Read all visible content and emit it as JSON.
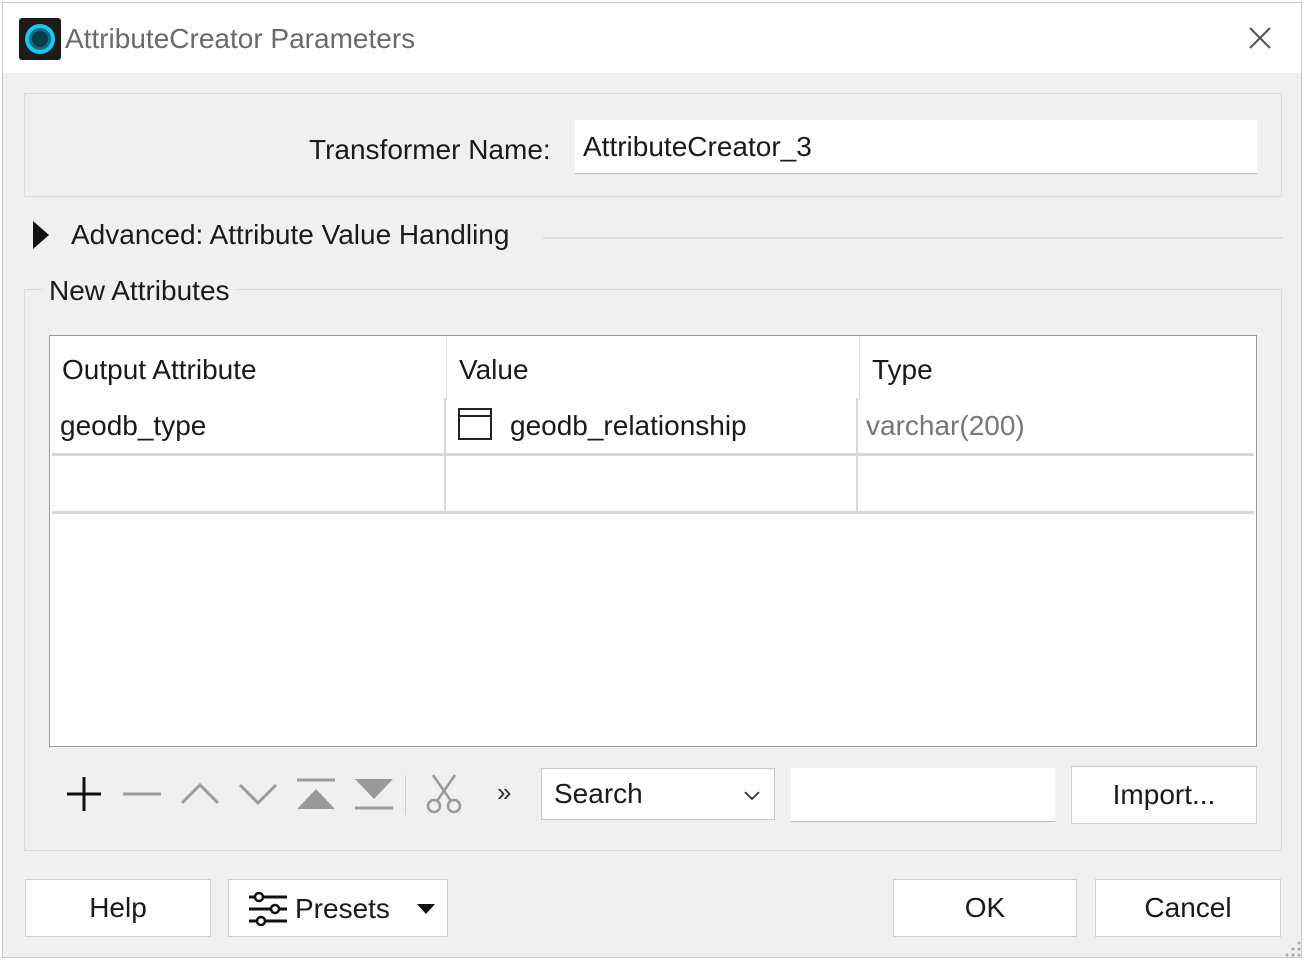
{
  "window": {
    "title": "AttributeCreator Parameters",
    "accent_color": "#18c8e8"
  },
  "transformer": {
    "label": "Transformer Name:",
    "value": "AttributeCreator_3"
  },
  "advanced": {
    "label": "Advanced: Attribute Value Handling",
    "expanded": false
  },
  "new_attributes": {
    "section_label": "New Attributes",
    "columns": [
      "Output Attribute",
      "Value",
      "Type"
    ],
    "rows": [
      {
        "output_attribute": "geodb_type",
        "value": "geodb_relationship",
        "type": "varchar(200)"
      },
      {
        "output_attribute": "",
        "value": "",
        "type": ""
      }
    ]
  },
  "toolbar": {
    "icons": [
      "add-icon",
      "remove-icon",
      "move-up-icon",
      "move-down-icon",
      "move-top-icon",
      "move-bottom-icon",
      "cut-icon"
    ],
    "more_label": "»",
    "search_select_value": "Search",
    "search_input_value": "",
    "import_label": "Import..."
  },
  "footer": {
    "help_label": "Help",
    "presets_label": "Presets",
    "ok_label": "OK",
    "cancel_label": "Cancel"
  }
}
